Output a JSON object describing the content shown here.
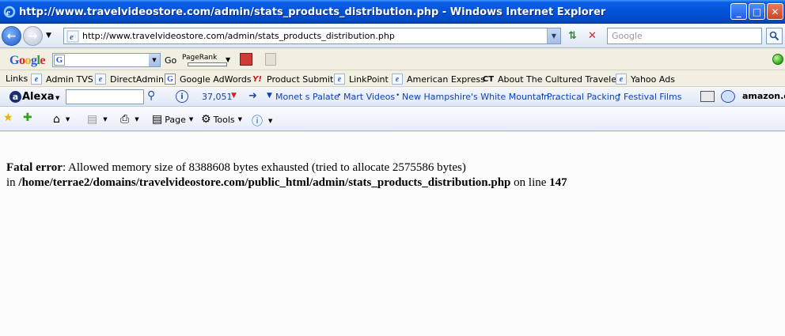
{
  "window": {
    "title": "http://www.travelvideostore.com/admin/stats_products_distribution.php - Windows Internet Explorer",
    "buttons": {
      "minimize": "_",
      "maximize": "□",
      "close": "✕"
    }
  },
  "address_bar": {
    "url": "http://www.travelvideostore.com/admin/stats_products_distribution.php",
    "search_placeholder": "Google"
  },
  "google_toolbar": {
    "logo": [
      "G",
      "o",
      "o",
      "g",
      "l",
      "e"
    ],
    "go_label": "Go",
    "pagerank_label": "PageRank"
  },
  "links_bar": {
    "label": "Links",
    "items": [
      {
        "label": "Admin TVS",
        "icon": "ie-page-icon"
      },
      {
        "label": "DirectAdmin",
        "icon": "ie-page-icon"
      },
      {
        "label": "Google AdWords",
        "icon": "google-icon"
      },
      {
        "label": "Product Submit",
        "icon": "yahoo-icon"
      },
      {
        "label": "LinkPoint",
        "icon": "ie-page-icon"
      },
      {
        "label": "American Express",
        "icon": "ie-page-icon"
      },
      {
        "label": "About The Cultured Traveler",
        "icon": "ct-news-icon"
      },
      {
        "label": "Yahoo Ads",
        "icon": "ie-page-icon"
      }
    ]
  },
  "alexa_bar": {
    "logo": "Alexa",
    "rank": "37,051",
    "links": [
      "Monet s Palate",
      "Mart Videos",
      "New Hampshire's White Mountain...",
      "Practical Packing",
      "Festival Films"
    ],
    "amazon": "amazon.com"
  },
  "command_bar": {
    "page_label": "Page",
    "tools_label": "Tools"
  },
  "content": {
    "error_label": "Fatal error",
    "error_message": ": Allowed memory size of 8388608 bytes exhausted (tried to allocate 2575586 bytes)",
    "in_text": "in ",
    "path": "/home/terrae2/domains/travelvideostore.com/public_html/admin/stats_products_distribution.php",
    "on_line_text": " on line ",
    "line_number": "147"
  }
}
